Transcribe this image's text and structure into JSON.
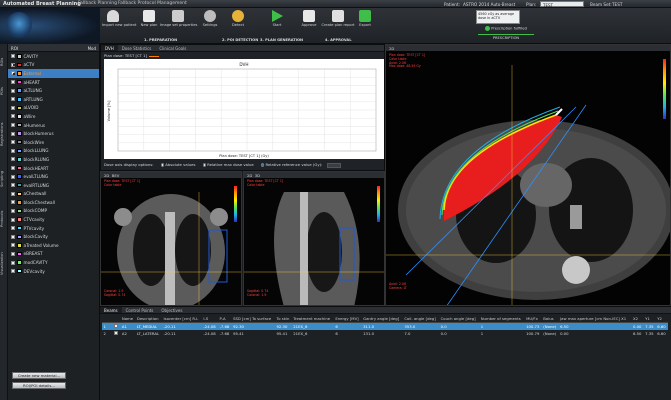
{
  "app": {
    "title": "Automated Breast Planning",
    "protocol_tabs": [
      "Fallback Planning",
      "Fallback Protocol Management"
    ],
    "patient_label": "Patient:",
    "patient_value": "ASTRO 2014 Auto-Breast",
    "plan_label": "Plan:",
    "plan_value": "TEST",
    "beamset_label": "Beam Set:",
    "beamset_value": "TEST"
  },
  "toolbar": {
    "buttons": [
      {
        "label": "Import new patient",
        "icon": "user-import-icon",
        "color": "#d9d9d9"
      },
      {
        "label": "New plan",
        "icon": "new-plan-icon",
        "color": "#e8e8e8"
      },
      {
        "label": "Image set properties",
        "icon": "image-properties-icon",
        "color": "#cccccc"
      },
      {
        "label": "Settings",
        "icon": "gear-icon",
        "color": "#bdbdbd"
      },
      {
        "label": "Detect",
        "icon": "detect-icon",
        "color": "#e6b23a"
      },
      {
        "label": "Start",
        "icon": "play-icon",
        "color": "#3fbf4a"
      },
      {
        "label": "Approve",
        "icon": "approve-icon",
        "color": "#e8e8e8"
      },
      {
        "label": "Create plan report",
        "icon": "report-icon",
        "color": "#e0e0e0"
      },
      {
        "label": "Export",
        "icon": "export-icon",
        "color": "#3fbf4a"
      }
    ],
    "stages": [
      "1. PREPARATION",
      "2. POI DETECTION",
      "3. PLAN GENERATION",
      "4. APPROVAL"
    ],
    "dose_box": "4560 cGy as average dose in aCTV",
    "prescription_status": "Prescription fulfilled",
    "prescription_label": "PRESCRIPTION"
  },
  "vtabs": [
    "ROIs",
    "POIs",
    "Registrations",
    "Scripting",
    "Protocols",
    "Visualization"
  ],
  "roi_panel": {
    "header": "ROI",
    "header_right": "Mod",
    "items": [
      {
        "name": "CAVITY",
        "color": "#c8c8c8",
        "checked": false
      },
      {
        "name": "aCTV",
        "color": "#e03030",
        "checked": true
      },
      {
        "name": "External",
        "color": "#ff9a28",
        "checked": true,
        "selected": true
      },
      {
        "name": "aHEART",
        "color": "#ff3fd0",
        "checked": false
      },
      {
        "name": "aLTLUNG",
        "color": "#5fa0ff",
        "checked": false
      },
      {
        "name": "aRTLUNG",
        "color": "#40c0ff",
        "checked": false
      },
      {
        "name": "aLVOID",
        "color": "#d0d050",
        "checked": false
      },
      {
        "name": "aWire",
        "color": "#e0e0e0",
        "checked": false
      },
      {
        "name": "aHumerus",
        "color": "#b0b0b0",
        "checked": false
      },
      {
        "name": "blockHumerus",
        "color": "#c090e0",
        "checked": false
      },
      {
        "name": "blockWire",
        "color": "#909090",
        "checked": false
      },
      {
        "name": "blockLLUNG",
        "color": "#80a0ff",
        "checked": false
      },
      {
        "name": "blockRLUNG",
        "color": "#60d0d0",
        "checked": false
      },
      {
        "name": "blockHEART",
        "color": "#ff60a0",
        "checked": false
      },
      {
        "name": "evalLTLUNG",
        "color": "#4060ff",
        "checked": false
      },
      {
        "name": "evalRTLUNG",
        "color": "#40a0a0",
        "checked": false
      },
      {
        "name": "aChestwall",
        "color": "#ffd060",
        "checked": false
      },
      {
        "name": "blockChestwall",
        "color": "#e0a040",
        "checked": false
      },
      {
        "name": "blockCOMP",
        "color": "#90e090",
        "checked": false
      },
      {
        "name": "CTVcavity",
        "color": "#ff8080",
        "checked": false
      },
      {
        "name": "PTVcavity",
        "color": "#40e0ff",
        "checked": false
      },
      {
        "name": "blockCavity",
        "color": "#a0a0ff",
        "checked": false
      },
      {
        "name": "aTreated Volume",
        "color": "#e0e040",
        "checked": false
      },
      {
        "name": "eBREAST",
        "color": "#ff60ff",
        "checked": false
      },
      {
        "name": "modCAVITY",
        "color": "#60ff60",
        "checked": false
      },
      {
        "name": "DEVcavity",
        "color": "#a0ffff",
        "checked": false
      }
    ],
    "buttons": [
      "Create new material...",
      "ROI/POI details..."
    ]
  },
  "dvh": {
    "tabs": [
      "DVH",
      "Dose Statistics",
      "Clinical Goals"
    ],
    "plan_dose_label": "Plan dose: TEST [CT 1]",
    "options_label": "Dose axis display options:",
    "options": [
      "Absolute values",
      "Relative max dose value",
      "Relative reference value (Gy):"
    ],
    "selected_option": 2
  },
  "chart_data": {
    "type": "line",
    "title": "DVH",
    "xlabel": "Plan dose: TEST [CT 1] (Gy)",
    "ylabel": "Volume [%]",
    "series": []
  },
  "viewports": {
    "coronal": {
      "tabs": [
        "2D",
        "BEV"
      ],
      "annot_left": "Plan dose: TEST [CT 1]\nColor table",
      "annot_bottom": "Coronal: 1.9\nSagittal: 0.74",
      "corner": "Camera: LT"
    },
    "sagittal": {
      "tabs": [
        "2D",
        "3D"
      ],
      "annot_left": "Plan dose: TEST [CT 1]\nColor table",
      "annot_bottom": "Sagittal: 0.74\nCoronal: 1.9",
      "corner": "Camera: LT"
    },
    "axial": {
      "tabs": [
        "2D"
      ],
      "annot_left": "Plan dose: TEST [CT 1]\nColor table\nAxial: 2.06\nMax dose: 48.59 Gy",
      "annot_bottom": "Axial: 2.06\nCamera: LT",
      "corner": "Camera: LT"
    }
  },
  "beams": {
    "tabs": [
      "Beams",
      "Control Points",
      "Objectives"
    ],
    "headers": [
      "",
      "Name",
      "Description",
      "Isocenter [cm] R-L",
      "I-S",
      "P-A",
      "SSD [cm] To surface",
      "To skin",
      "Treatment machine",
      "Energy [MV]",
      "Gantry angle [deg]",
      "Coll. angle [deg]",
      "Couch angle [deg]",
      "Number of segments",
      "MU/Fx",
      "Bolus",
      "Jaw max aperture [cm Non-IEC] X1",
      "X2",
      "Y1",
      "Y2"
    ],
    "rows": [
      {
        "num": "1",
        "name": "A1",
        "desc": "LT_MEDIAL",
        "rl": "-20.11",
        "is": "-24.08",
        "pa": "-7.68",
        "ssd": "92.30",
        "skin": "92.30",
        "machine": "21EX_6",
        "energy": "6",
        "gantry": "311.0",
        "coll": "353.0",
        "couch": "0.0",
        "segs": "1",
        "mu": "100.73",
        "bolus": "(None)",
        "x1": "6.50",
        "x2": "0.00",
        "y1": "7.35",
        "y2": "6.60",
        "selected": true
      },
      {
        "num": "2",
        "name": "A2",
        "desc": "LT_LATERAL",
        "rl": "-20.11",
        "is": "-24.08",
        "pa": "-7.68",
        "ssd": "95.41",
        "skin": "95.41",
        "machine": "21EX_6",
        "energy": "6",
        "gantry": "131.0",
        "coll": "7.0",
        "couch": "0.0",
        "segs": "1",
        "mu": "100.79",
        "bolus": "(None)",
        "x1": "0.00",
        "x2": "6.50",
        "y1": "7.35",
        "y2": "6.60",
        "selected": false
      }
    ]
  }
}
